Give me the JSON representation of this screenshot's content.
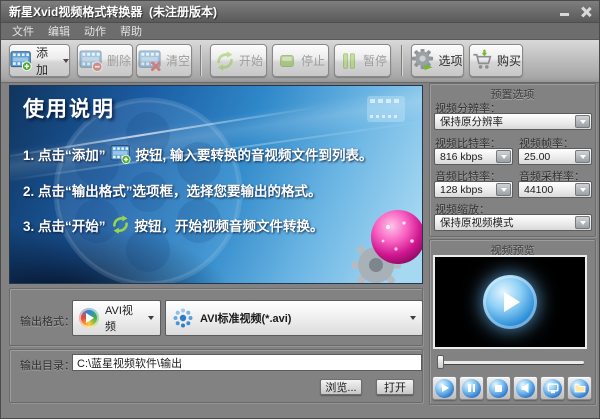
{
  "window": {
    "title": "新星Xvid视频格式转换器  (未注册版本)"
  },
  "menu": {
    "items": [
      "文件",
      "编辑",
      "动作",
      "帮助"
    ]
  },
  "toolbar": {
    "add": "添加",
    "remove": "删除",
    "clear": "清空",
    "start": "开始",
    "stop": "停止",
    "pause": "暂停",
    "options": "选项",
    "buy": "购买"
  },
  "banner": {
    "title": "使用说明",
    "step1_pre": "1. 点击“添加”",
    "step1_post": "按钮, 输入要转换的音视频文件到列表。",
    "step2": "2. 点击“输出格式”选项框，选择您要输出的格式。",
    "step3_pre": "3. 点击“开始”",
    "step3_post": "按钮，开始视频音频文件转换。"
  },
  "presets": {
    "title": "预置选项",
    "resolution_label": "视频分辨率：",
    "resolution_value": "保持原分辨率",
    "video_bitrate_label": "视频比特率：",
    "video_bitrate_value": "816 kbps",
    "framerate_label": "视频帧率：",
    "framerate_value": "25.00",
    "audio_bitrate_label": "音频比特率：",
    "audio_bitrate_value": "128 kbps",
    "samplerate_label": "音频采样率：",
    "samplerate_value": "44100",
    "scale_label": "视频缩放：",
    "scale_value": "保持原视频模式"
  },
  "preview": {
    "title": "视频预览"
  },
  "output_format": {
    "label": "输出格式：",
    "container_value": "AVI视频",
    "profile_value": "AVI标准视频(*.avi)"
  },
  "output_dir": {
    "label": "输出目录：",
    "value": "C:\\蓝星视频软件\\输出",
    "browse": "浏览...",
    "open": "打开"
  },
  "colors": {
    "banner_blue": "#1b5ca3",
    "action_green": "#8cc63e",
    "sphere_pink": "#d6189a",
    "preview_icon_blue": "#2a72c8"
  }
}
